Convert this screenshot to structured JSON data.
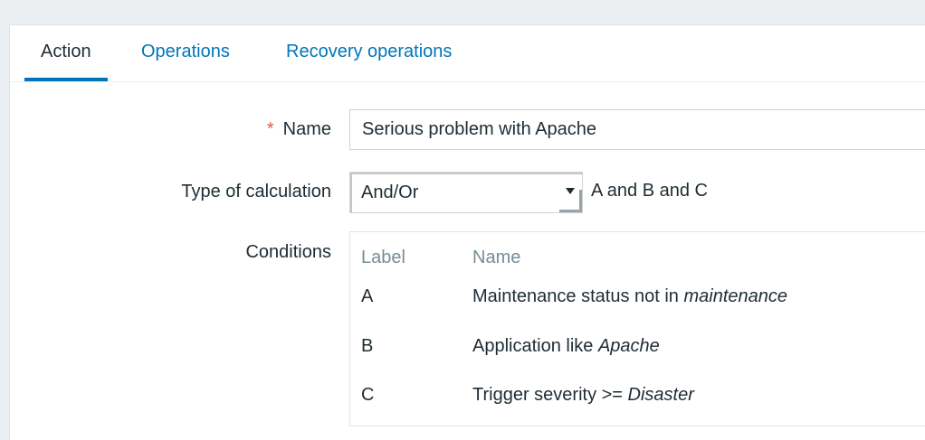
{
  "tabs": [
    {
      "label": "Action",
      "active": true
    },
    {
      "label": "Operations",
      "active": false
    },
    {
      "label": "Recovery operations",
      "active": false
    }
  ],
  "form": {
    "name": {
      "required_marker": "*",
      "label": "Name",
      "value": "Serious problem with Apache"
    },
    "calculation": {
      "label": "Type of calculation",
      "selected": "And/Or",
      "formula": "A and B and C"
    },
    "conditions": {
      "label": "Conditions",
      "columns": {
        "label": "Label",
        "name": "Name"
      },
      "rows": [
        {
          "label": "A",
          "text": "Maintenance status not in ",
          "value": "maintenance"
        },
        {
          "label": "B",
          "text": "Application like ",
          "value": "Apache"
        },
        {
          "label": "C",
          "text": "Trigger severity >= ",
          "value": "Disaster"
        }
      ]
    }
  },
  "colors": {
    "link": "#0275b8",
    "required": "#e45959",
    "header_text": "#768d99",
    "page_bg": "#ebeef0"
  }
}
